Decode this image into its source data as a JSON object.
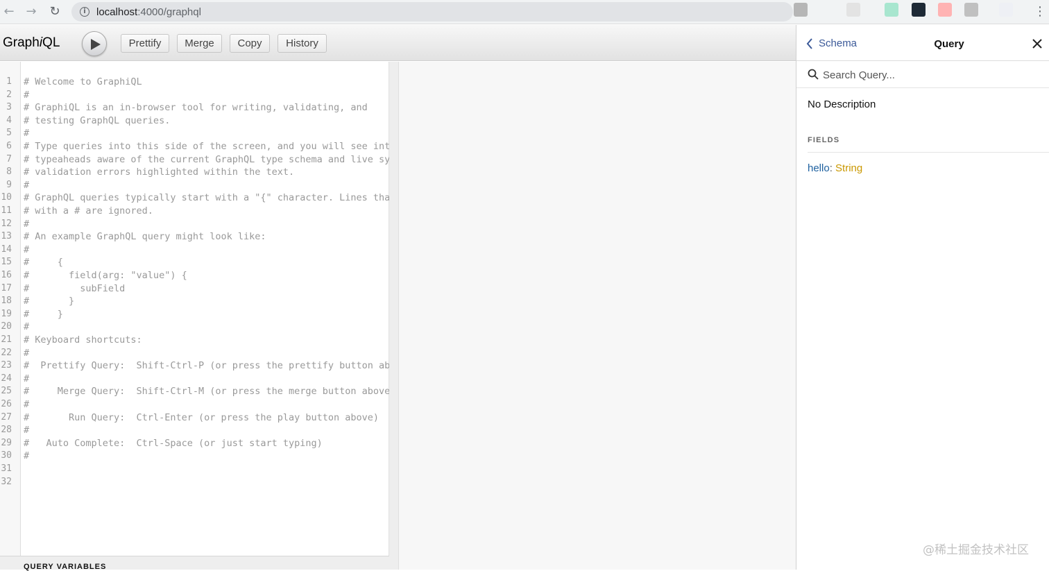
{
  "browser": {
    "url_host": "localhost",
    "url_path": ":4000/graphql",
    "back_icon": "←",
    "forward_icon": "→",
    "reload_icon": "↻",
    "info_icon": "i",
    "menu_icon": "⋮",
    "extension_colors": [
      "#b6b6b6",
      "#e3e3e3",
      "#a8e6cf",
      "#1e2a36",
      "#ffb3b3",
      "#c0c0c0",
      "#eef0f5"
    ]
  },
  "toolbar": {
    "logo_prefix": "Graph",
    "logo_italic": "i",
    "logo_suffix": "QL",
    "prettify_label": "Prettify",
    "merge_label": "Merge",
    "copy_label": "Copy",
    "history_label": "History"
  },
  "editor": {
    "lines": [
      "# Welcome to GraphiQL",
      "#",
      "# GraphiQL is an in-browser tool for writing, validating, and",
      "# testing GraphQL queries.",
      "#",
      "# Type queries into this side of the screen, and you will see intelligent",
      "# typeaheads aware of the current GraphQL type schema and live syntax and",
      "# validation errors highlighted within the text.",
      "#",
      "# GraphQL queries typically start with a \"{\" character. Lines that start",
      "# with a # are ignored.",
      "#",
      "# An example GraphQL query might look like:",
      "#",
      "#     {",
      "#       field(arg: \"value\") {",
      "#         subField",
      "#       }",
      "#     }",
      "#",
      "# Keyboard shortcuts:",
      "#",
      "#  Prettify Query:  Shift-Ctrl-P (or press the prettify button above)",
      "#",
      "#     Merge Query:  Shift-Ctrl-M (or press the merge button above)",
      "#",
      "#       Run Query:  Ctrl-Enter (or press the play button above)",
      "#",
      "#   Auto Complete:  Ctrl-Space (or just start typing)",
      "#",
      "",
      ""
    ],
    "query_variables_label": "QUERY VARIABLES"
  },
  "doc_explorer": {
    "back_label": "Schema",
    "title": "Query",
    "search_placeholder": "Search Query...",
    "description": "No Description",
    "fields_heading": "FIELDS",
    "fields": [
      {
        "name": "hello",
        "separator": ": ",
        "type": "String"
      }
    ]
  },
  "watermark": "@稀土掘金技术社区",
  "colors": {
    "link": "#3b5998",
    "field_name": "#1f61a0",
    "type_name": "#ca9800",
    "comment": "#999999"
  }
}
